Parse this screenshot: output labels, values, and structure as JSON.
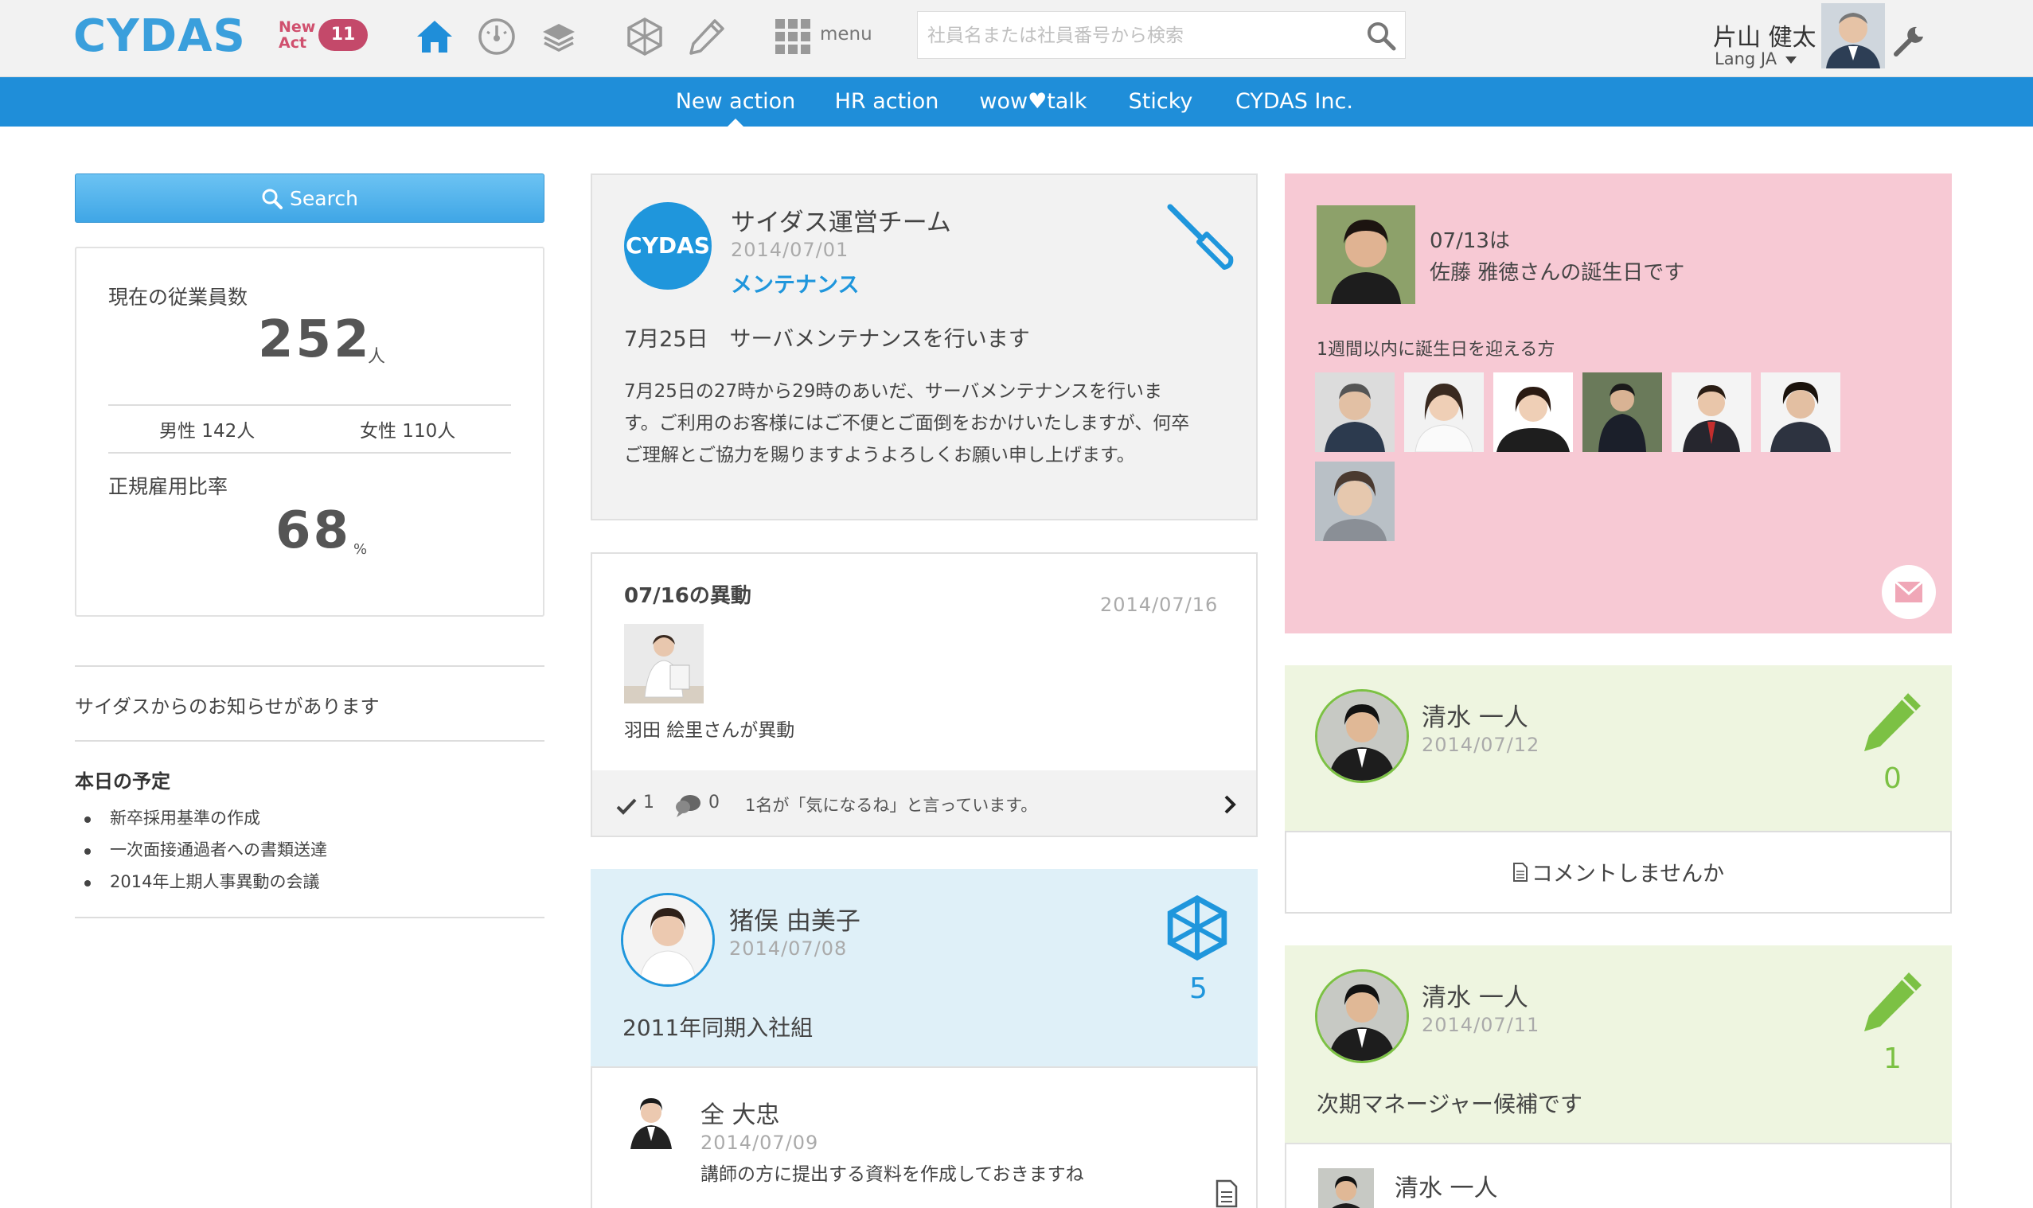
{
  "header": {
    "logo": "CYDAS",
    "new_label_1": "New",
    "new_label_2": "Act",
    "new_count": "11",
    "menu_label": "menu",
    "search_placeholder": "社員名または社員番号から検索",
    "user_name": "片山 健太",
    "lang_label": "Lang JA"
  },
  "nav": {
    "items": [
      "New action",
      "HR action",
      "wow♥talk",
      "Sticky",
      "CYDAS Inc."
    ]
  },
  "left": {
    "search_label": "Search",
    "employees_label": "現在の従業員数",
    "employees_count": "252",
    "employees_unit": "人",
    "male": "男性 142人",
    "female": "女性 110人",
    "regular_label": "正規雇用比率",
    "regular_value": "68",
    "regular_unit": "%",
    "notice": "サイダスからのお知らせがあります",
    "today_title": "本日の予定",
    "today_items": [
      "新卒採用基準の作成",
      "一次面接通過者への書類送達",
      "2014年上期人事異動の会議"
    ]
  },
  "middle": {
    "post1": {
      "avatar_text": "CYDAS",
      "team": "サイダス運営チーム",
      "date": "2014/07/01",
      "category": "メンテナンス",
      "headline": "7月25日　サーバメンテナンスを行います",
      "body_lines": [
        "7月25日の27時から29時のあいだ、サーバメンテナンスを行いま",
        "す。ご利用のお客様にはご不便とご面倒をおかけいたしますが、何卒",
        "ご理解とご協力を賜りますようよろしくお願い申し上げます。"
      ]
    },
    "post2": {
      "title": "07/16の異動",
      "date": "2014/07/16",
      "caption": "羽田 絵里さんが異動",
      "check_count": "1",
      "comment_count": "0",
      "like_text": "1名が「気になるね」と言っています。"
    },
    "post3": {
      "name": "猪俣 由美子",
      "date": "2014/07/08",
      "count": "5",
      "text": "2011年同期入社組"
    },
    "post4": {
      "name": "全 大忠",
      "date": "2014/07/09",
      "text": "講師の方に提出する資料を作成しておきますね"
    }
  },
  "right": {
    "birthday": {
      "line1": "07/13は",
      "line2": "佐藤 雅徳さんの誕生日です",
      "week_label": "1週間以内に誕生日を迎える方"
    },
    "post1": {
      "name": "清水 一人",
      "date": "2014/07/12",
      "count": "0",
      "comment_prompt": "コメントしませんか"
    },
    "post2": {
      "name": "清水 一人",
      "date": "2014/07/11",
      "count": "1",
      "text": "次期マネージャー候補です",
      "reply_name": "清水 一人"
    }
  },
  "colors": {
    "brand_blue": "#1f8ed9",
    "pink_card": "#f7c9d4",
    "green_card": "#eef5e0",
    "blue_card": "#dff0f8",
    "accent_green": "#7cc144",
    "badge_red": "#c4496a"
  }
}
